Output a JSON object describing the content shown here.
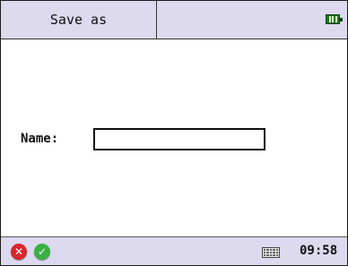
{
  "title_bar": {
    "title": "Save as",
    "battery_icon": "battery-icon",
    "battery_color": "#1b7a1b"
  },
  "form": {
    "name_label": "Name:",
    "name_value": "",
    "name_placeholder": ""
  },
  "status_bar": {
    "cancel_icon": "cancel-icon",
    "cancel_glyph": "✕",
    "cancel_color": "#d8262e",
    "ok_icon": "ok-icon",
    "ok_glyph": "✓",
    "ok_color": "#3ab043",
    "keyboard_icon": "keyboard-icon",
    "time": "09:58"
  },
  "colors": {
    "bar_background": "#ddd9ef",
    "content_background": "#ffffff"
  }
}
